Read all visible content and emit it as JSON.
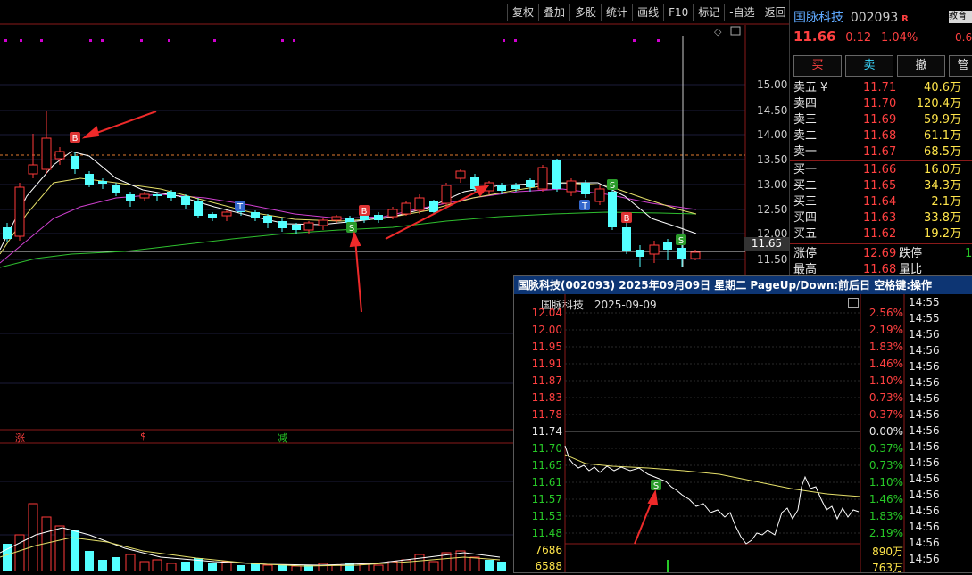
{
  "toolbar": [
    "复权",
    "叠加",
    "多股",
    "统计",
    "画线",
    "F10",
    "标记",
    "-自选",
    "返回"
  ],
  "main_chart": {
    "price_ticks": [
      "15.00",
      "14.50",
      "14.00",
      "13.50",
      "13.00",
      "12.50",
      "12.00",
      "11.50"
    ],
    "last_price_label": "11.65",
    "markers": [
      "涨",
      "$",
      "减"
    ]
  },
  "quote": {
    "name": "国脉科技",
    "code": "002093",
    "badge": "R",
    "side_tab": "教育",
    "side_val": "0.6",
    "price": "11.66",
    "change": "0.12",
    "change_pct": "1.04%",
    "buttons": [
      "买",
      "卖",
      "撤",
      "管"
    ],
    "asks": [
      {
        "label": "卖五",
        "price": "11.71",
        "vol": "40.6万"
      },
      {
        "label": "卖四",
        "price": "11.70",
        "vol": "120.4万"
      },
      {
        "label": "卖三",
        "price": "11.69",
        "vol": "59.9万"
      },
      {
        "label": "卖二",
        "price": "11.68",
        "vol": "61.1万"
      },
      {
        "label": "卖一",
        "price": "11.67",
        "vol": "68.5万"
      }
    ],
    "bids": [
      {
        "label": "买一",
        "price": "11.66",
        "vol": "16.0万"
      },
      {
        "label": "买二",
        "price": "11.65",
        "vol": "34.3万"
      },
      {
        "label": "买三",
        "price": "11.64",
        "vol": "2.1万"
      },
      {
        "label": "买四",
        "price": "11.63",
        "vol": "33.8万"
      },
      {
        "label": "买五",
        "price": "11.62",
        "vol": "19.2万"
      }
    ],
    "limit_up_label": "涨停",
    "limit_up": "12.69",
    "limit_down_label": "跌停",
    "limit_down_val": "1",
    "high_label": "最高",
    "high": "11.68",
    "ratio_label": "量比"
  },
  "popup": {
    "title": "国脉科技(002093)  2025年09月09日  星期二  PageUp/Down:前后日  空格键:操作",
    "subtitle_name": "国脉科技",
    "subtitle_date": "2025-09-09",
    "left_ticks": [
      "12.04",
      "12.00",
      "11.95",
      "11.91",
      "11.87",
      "11.83",
      "11.78",
      "11.74",
      "11.70",
      "11.65",
      "11.61",
      "11.57",
      "11.53",
      "11.48"
    ],
    "right_ticks": [
      "2.56%",
      "2.19%",
      "1.83%",
      "1.46%",
      "1.10%",
      "0.73%",
      "0.37%",
      "0.00%",
      "0.37%",
      "0.73%",
      "1.10%",
      "1.46%",
      "1.83%",
      "2.19%"
    ],
    "vol_left": [
      "7686",
      "6588"
    ],
    "vol_right": [
      "890万",
      "763万"
    ],
    "times": [
      "14:55",
      "14:55",
      "14:56",
      "14:56",
      "14:56",
      "14:56",
      "14:56",
      "14:56",
      "14:56",
      "14:56",
      "14:56",
      "14:56",
      "14:56",
      "14:56",
      "14:56",
      "14:56",
      "14:56"
    ]
  }
}
